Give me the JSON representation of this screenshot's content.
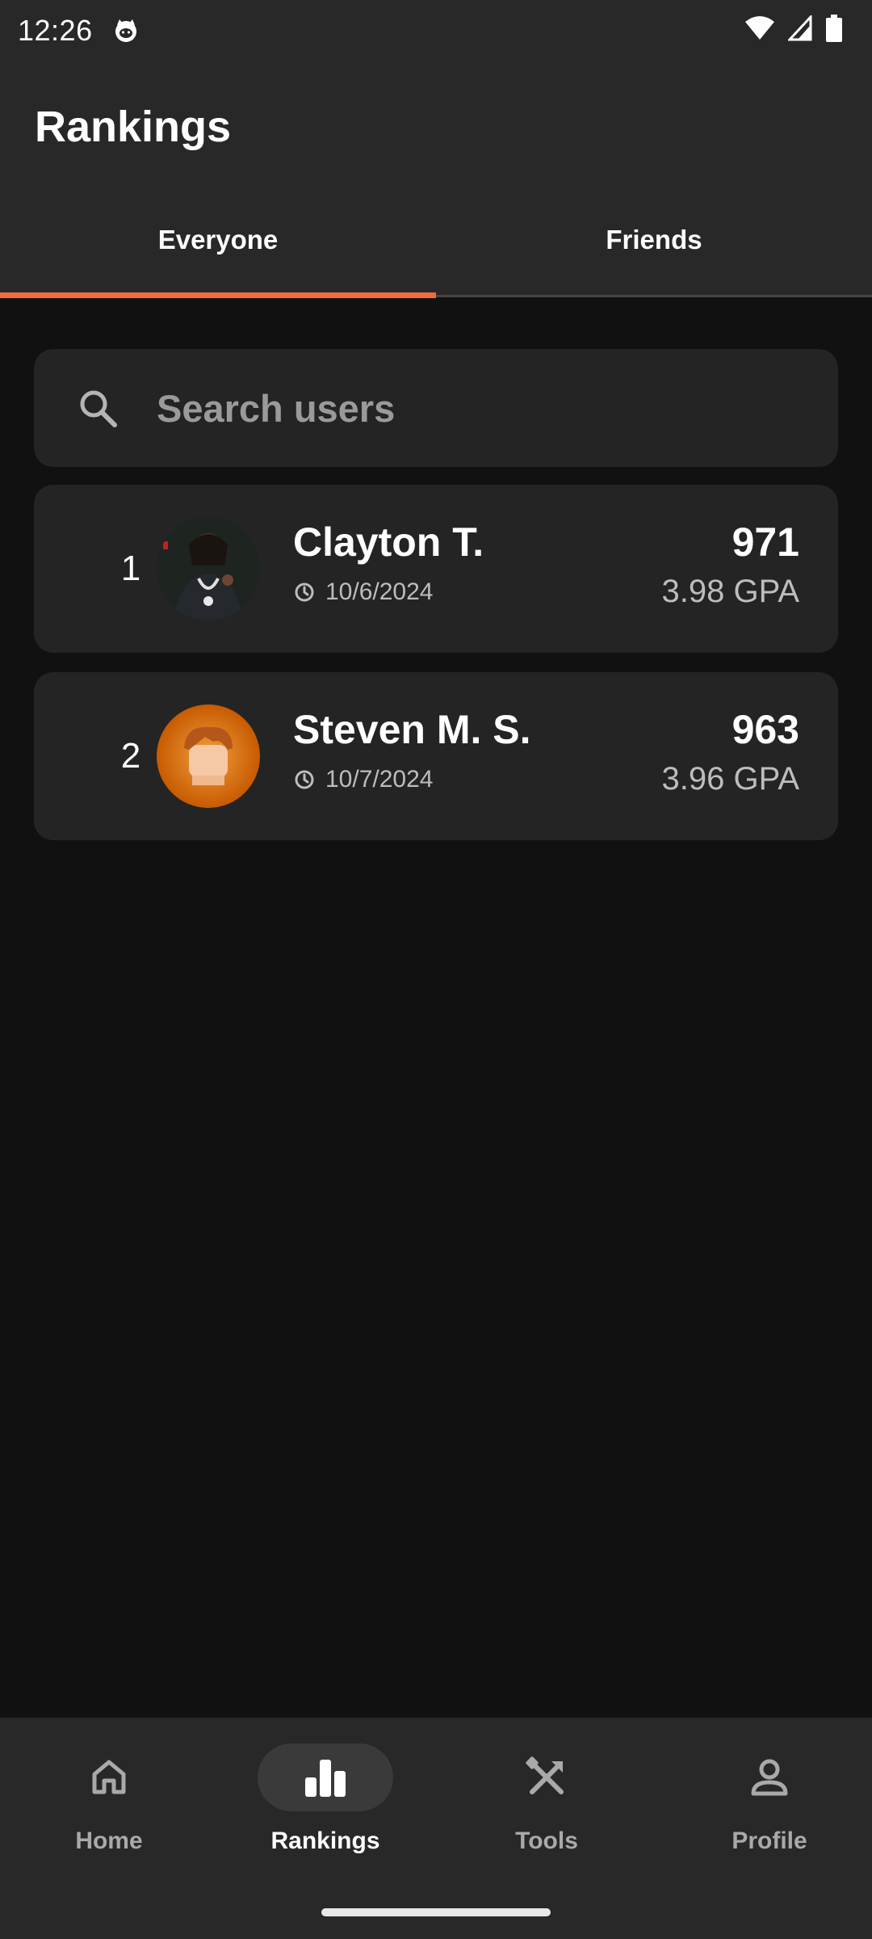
{
  "status_bar": {
    "time": "12:26"
  },
  "header": {
    "title": "Rankings"
  },
  "tabs": [
    {
      "label": "Everyone",
      "active": true
    },
    {
      "label": "Friends",
      "active": false
    }
  ],
  "search": {
    "placeholder": "Search users",
    "value": ""
  },
  "rankings": [
    {
      "rank": "1",
      "name": "Clayton T.",
      "date": "10/6/2024",
      "score": "971",
      "gpa": "3.98 GPA"
    },
    {
      "rank": "2",
      "name": "Steven M. S.",
      "date": "10/7/2024",
      "score": "963",
      "gpa": "3.96 GPA"
    }
  ],
  "bottom_nav": [
    {
      "label": "Home",
      "icon": "home-icon",
      "active": false
    },
    {
      "label": "Rankings",
      "icon": "bar-chart-icon",
      "active": true
    },
    {
      "label": "Tools",
      "icon": "tools-icon",
      "active": false
    },
    {
      "label": "Profile",
      "icon": "person-icon",
      "active": false
    }
  ],
  "colors": {
    "accent": "#f26a3d",
    "background": "#111111",
    "surface": "#242424",
    "header": "#282828"
  }
}
